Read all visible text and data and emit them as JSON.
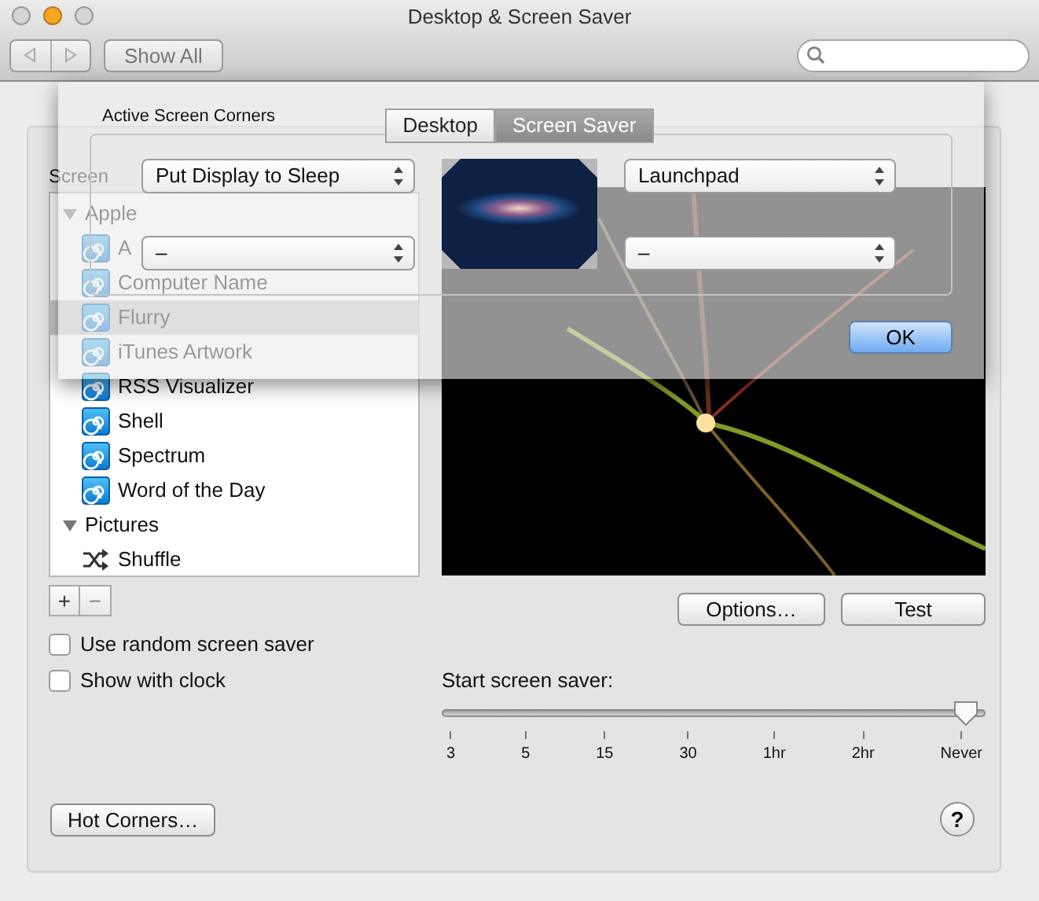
{
  "window": {
    "title": "Desktop & Screen Saver"
  },
  "toolbar": {
    "show_all": "Show All"
  },
  "tabs": [
    {
      "label": "Desktop",
      "selected": false
    },
    {
      "label": "Screen Saver",
      "selected": true
    }
  ],
  "screen_savers": {
    "label": "Screen",
    "tree": [
      {
        "label": "Apple",
        "expanded": true,
        "children": [
          {
            "label": "A",
            "kind": "module",
            "selected": false
          },
          {
            "label": "Computer Name",
            "kind": "module",
            "selected": false
          },
          {
            "label": "Flurry",
            "kind": "module",
            "selected": true
          },
          {
            "label": "iTunes Artwork",
            "kind": "module",
            "selected": false
          },
          {
            "label": "RSS Visualizer",
            "kind": "module",
            "selected": false
          },
          {
            "label": "Shell",
            "kind": "module",
            "selected": false
          },
          {
            "label": "Spectrum",
            "kind": "module",
            "selected": false
          },
          {
            "label": "Word of the Day",
            "kind": "module",
            "selected": false
          }
        ]
      },
      {
        "label": "Pictures",
        "expanded": true,
        "children": [
          {
            "label": "Shuffle",
            "kind": "shuffle",
            "selected": false
          }
        ]
      }
    ]
  },
  "list_buttons": [
    "+",
    "−"
  ],
  "checkboxes": [
    {
      "label": "Use random screen saver",
      "checked": false
    },
    {
      "label": "Show with clock",
      "checked": false
    }
  ],
  "preview_buttons": [
    "Options…",
    "Test"
  ],
  "start_slider": {
    "label": "Start screen saver:",
    "level": 1,
    "ticks": [
      "3",
      "5",
      "15",
      "30",
      "1hr",
      "2hr",
      "Never"
    ]
  },
  "hot_corners_button": "Hot Corners…",
  "help": "?",
  "sheet": {
    "title": "Active Screen Corners",
    "corners": [
      {
        "value": "Put Display to Sleep"
      },
      {
        "value": "Launchpad"
      },
      {
        "value": "–"
      },
      {
        "value": "–"
      }
    ],
    "ok": "OK"
  }
}
